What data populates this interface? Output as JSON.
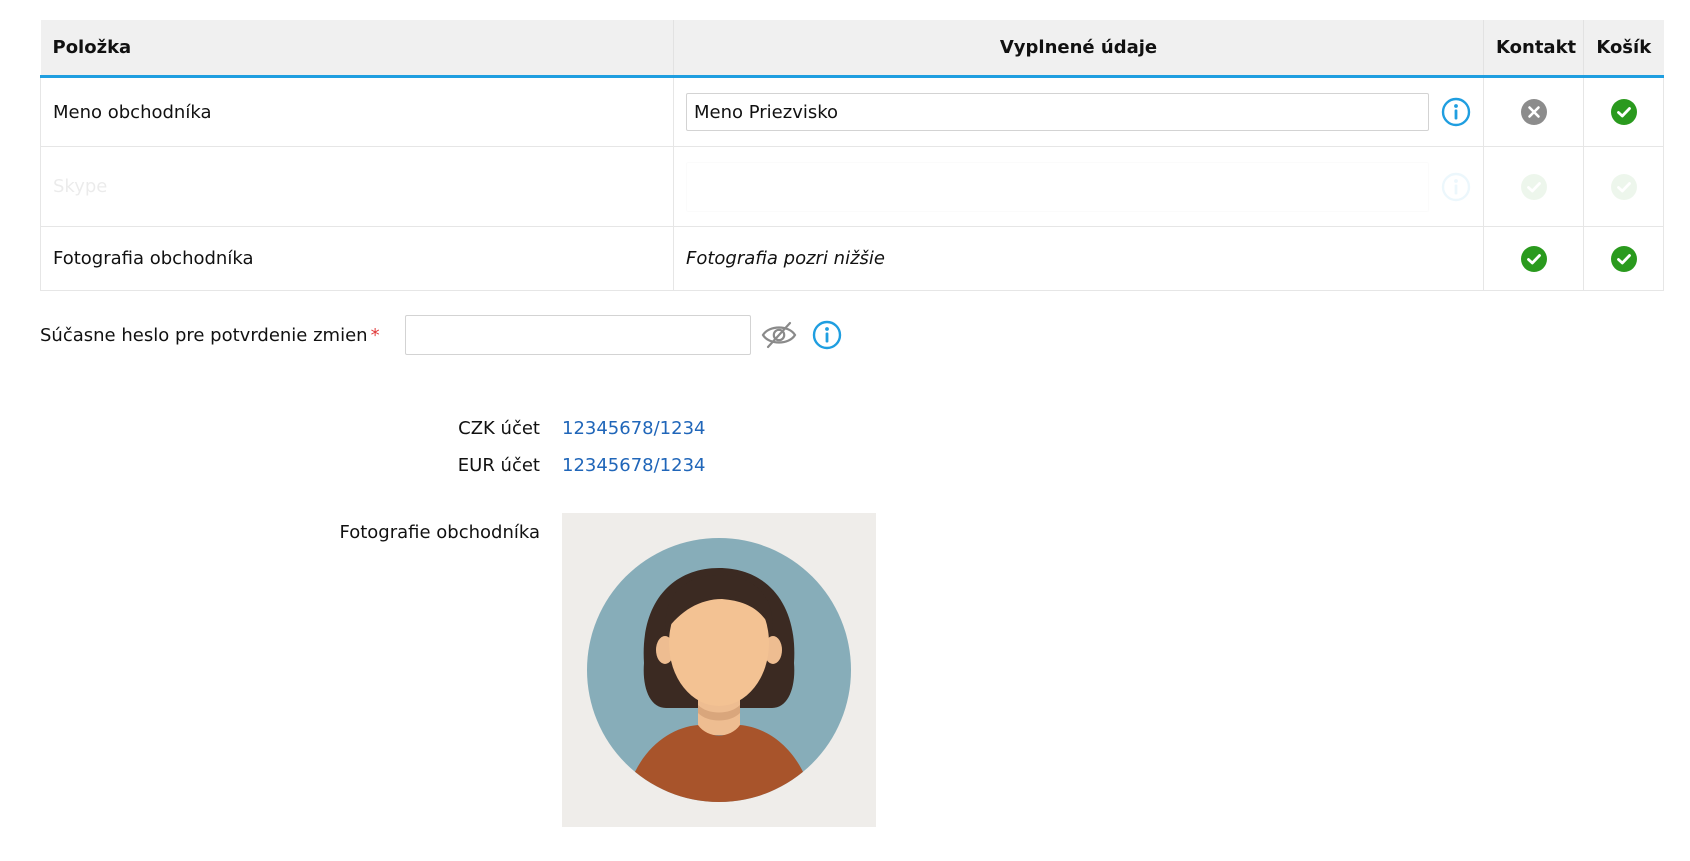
{
  "table": {
    "headers": {
      "item": "Položka",
      "value": "Vyplnené údaje",
      "contact": "Kontakt",
      "cart": "Košík"
    },
    "rows": [
      {
        "label": "Meno obchodníka",
        "value": "Meno Priezvisko",
        "contact": "no",
        "cart": "yes"
      },
      {
        "label": "Skype",
        "value": "",
        "contact": "yes",
        "cart": "yes"
      },
      {
        "label": "Fotografia obchodníka",
        "value": "Fotografia pozri nižšie",
        "contact": "yes",
        "cart": "yes"
      }
    ]
  },
  "password": {
    "label": "Súčasne heslo pre potvrdenie zmien",
    "required_mark": "*",
    "value": ""
  },
  "accounts": [
    {
      "label": "CZK účet",
      "value": "12345678/1234"
    },
    {
      "label": "EUR účet",
      "value": "12345678/1234"
    }
  ],
  "photo": {
    "label": "Fotografie obchodníka"
  },
  "icons": {
    "info": "info-circle-icon",
    "eye": "eye-slash-icon",
    "yes": "check-circle-icon",
    "no": "x-circle-icon"
  },
  "colors": {
    "accent": "#1f9ee0",
    "success": "#2a9a1e",
    "neutral": "#8c8c8c",
    "link": "#2066b9",
    "required": "#e03a3a"
  }
}
